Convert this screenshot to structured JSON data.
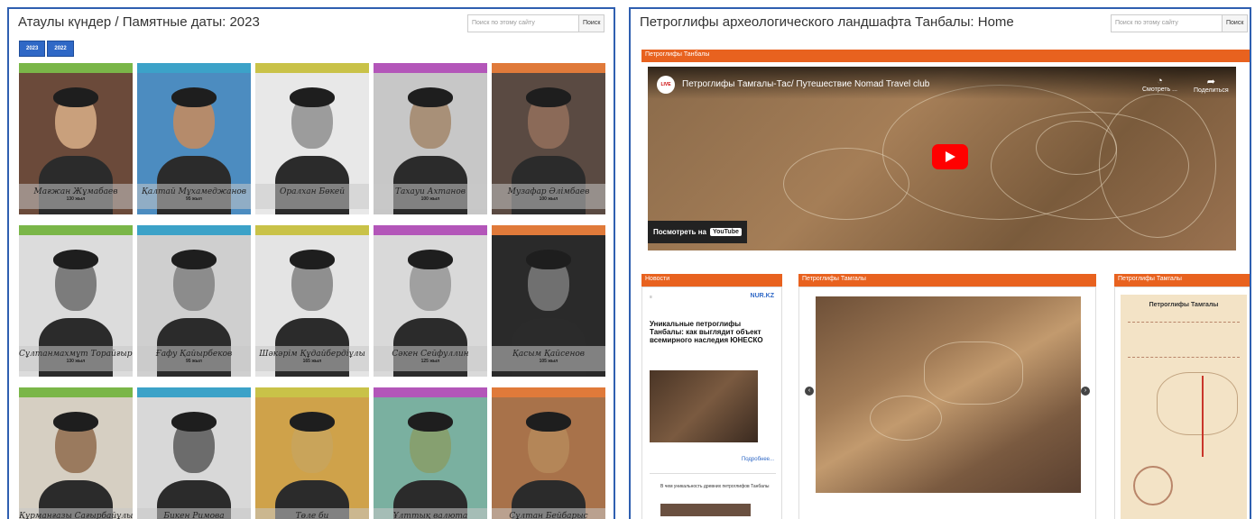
{
  "left_panel": {
    "title": "Атаулы күндер / Памятные даты: 2023",
    "search_placeholder": "Поиск по этому сайту",
    "search_button": "Поиск",
    "year_tabs": [
      "2023",
      "2022"
    ],
    "cards": [
      {
        "name": "Мағжан Жұмабаев",
        "years": "130 жыл",
        "band": "#7ab648"
      },
      {
        "name": "Қалтай Мұхамеджанов",
        "years": "95 жыл",
        "band": "#3ca2c8"
      },
      {
        "name": "Оралхан Бөкей",
        "years": "",
        "band": "#c9c248"
      },
      {
        "name": "Тахауи Ахтанов",
        "years": "100 жыл",
        "band": "#b356b9"
      },
      {
        "name": "Музафар Әлімбаев",
        "years": "100 жыл",
        "band": "#e07a3a"
      },
      {
        "name": "Сұлтанмахмұт Торайғыров",
        "years": "130 жыл",
        "band": "#7ab648"
      },
      {
        "name": "Ғафу Қайырбеков",
        "years": "95 жыл",
        "band": "#3ca2c8"
      },
      {
        "name": "Шәкәрім Құдайбердіұлы",
        "years": "165 жыл",
        "band": "#c9c248"
      },
      {
        "name": "Сәкен Сейфуллин",
        "years": "125 жыл",
        "band": "#b356b9"
      },
      {
        "name": "Қасым Қайсенов",
        "years": "105 жыл",
        "band": "#e07a3a"
      },
      {
        "name": "Құрманғазы Сағырбайұлы",
        "years": "",
        "band": "#7ab648"
      },
      {
        "name": "Бикен Римова",
        "years": "",
        "band": "#3ca2c8"
      },
      {
        "name": "Төле би",
        "years": "",
        "band": "#c9c248"
      },
      {
        "name": "Ұлттық валюта",
        "years": "",
        "band": "#b356b9"
      },
      {
        "name": "Сұлтан Бейбарыс",
        "years": "",
        "band": "#e07a3a"
      }
    ]
  },
  "right_panel": {
    "title": "Петроглифы археологического ландшафта Танбалы: Home",
    "search_placeholder": "Поиск по этому сайту",
    "search_button": "Поиск",
    "top_section_label": "Петроглифы Танбалы",
    "video": {
      "channel_badge": "LIVE",
      "title": "Петроглифы Тамгалы-Тас/ Путешествие Nomad Travel club",
      "watch_later": "Смотреть ...",
      "share": "Поделиться",
      "watch_on": "Посмотреть на",
      "youtube": "YouTube"
    },
    "news_label": "Новости",
    "news_brand": "NUR.KZ",
    "news_headline": "Уникальные петроглифы Танбалы: как выглядит объект всемирного наследия ЮНЕСКО",
    "news_more": "Подробнее...",
    "news_item2": "В чем уникальность древних петроглифов Танбалы",
    "gallery_label": "Петроглифы Тамгалы",
    "poster_label": "Петроглифы Тамгалы",
    "poster_title": "Петроглифы Тамгалы"
  },
  "colors": {
    "accent_blue": "#2f68c6",
    "section_orange": "#e8621f",
    "border_blue": "#2f5fb0"
  }
}
